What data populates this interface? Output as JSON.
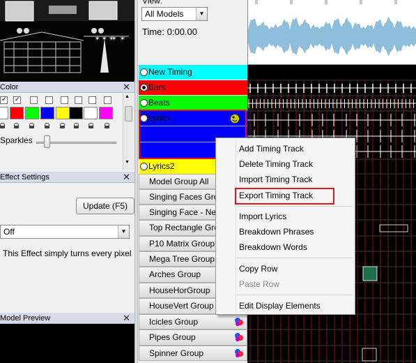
{
  "colors": {
    "new_timing": "#00ffff",
    "bars": "#ff0000",
    "beats": "#00ff00",
    "lyrics": "#0000ff",
    "lyrics2": "#ffff00",
    "highlight": "#e0161f"
  },
  "toolbar": {
    "view_label": "View:",
    "view_select": "All Models",
    "time_label": "Time: 0:00.00"
  },
  "color_panel": {
    "title": "Color",
    "sparkles_label": "Sparkles",
    "swatches": [
      "#ffffff",
      "#ff0000",
      "#00ff00",
      "#0000ff",
      "#ffff00",
      "#000000",
      "#ffffff",
      "#ff00ff"
    ]
  },
  "effect_panel": {
    "title": "Effect Settings",
    "update_button": "Update (F5)",
    "effect_select": "Off",
    "description": "This Effect simply turns every pixel"
  },
  "model_preview": {
    "title": "Model Preview"
  },
  "rows": {
    "timing": [
      "New Timing",
      "Bars",
      "Beats",
      "Lyrics",
      "Lyrics2"
    ],
    "models": [
      "Model Group All",
      "Singing Faces Gro",
      "Singing Face - Ne",
      "Top Rectangle Gro",
      "P10 Matrix Group",
      "Mega Tree Group",
      "Arches Group",
      "HouseHorGroup",
      "HouseVert Group",
      "Icicles Group",
      "Pipes Group",
      "Spinner Group"
    ]
  },
  "context_menu": {
    "add_timing_track": "Add Timing Track",
    "delete_timing_track": "Delete Timing Track",
    "import_timing_track": "Import Timing Track",
    "export_timing_track": "Export Timing Track",
    "import_lyrics": "Import Lyrics",
    "breakdown_phrases": "Breakdown Phrases",
    "breakdown_words": "Breakdown Words",
    "copy_row": "Copy Row",
    "paste_row": "Paste Row",
    "edit_display_elements": "Edit Display Elements"
  }
}
